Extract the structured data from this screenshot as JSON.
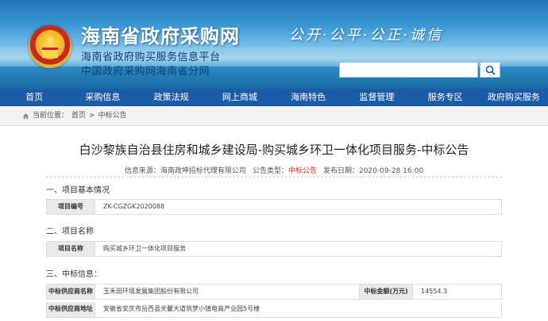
{
  "banner": {
    "site_title": "海南省政府采购网",
    "subtitle_1": "海南省政府购买服务信息平台",
    "subtitle_2": "中国政府采购网海南省分网",
    "slogan": "公开·公平·公正·诚信",
    "search_placeholder": ""
  },
  "nav": {
    "items": [
      "首页",
      "采购信息",
      "政策法规",
      "网上商城",
      "海南特色",
      "监督管理",
      "服务专区",
      "政府购买服务"
    ]
  },
  "breadcrumb": {
    "prefix": "当前位置：",
    "home": "首页",
    "separator": ">",
    "current": "中标公告"
  },
  "article": {
    "title": "白沙黎族自治县住房和城乡建设局-购买城乡环卫一体化项目服务-中标公告",
    "source_label": "信息来源：",
    "source_value": "海南政坤招标代理有限公司",
    "type_label": "公告类型：",
    "type_value": "中标公告",
    "date_label": "发布日期：",
    "date_value": "2020-09-28 16:00"
  },
  "sections": {
    "s1": {
      "heading": "一、项目基本情况",
      "label": "项目编号",
      "value": "ZK-CGZGK2020088"
    },
    "s2": {
      "heading": "二、项目名称",
      "label": "项目名称",
      "value": "购买城乡环卫一体化项目服务"
    },
    "s3": {
      "heading": "三、中标信息：",
      "supplier_label": "中标供应商名称",
      "supplier_value": "玉禾田环境发展集团股份有限公司",
      "amount_label": "中标金额(万元)",
      "amount_value": "14554.3",
      "address_label": "中标供应商地址",
      "address_value": "安徽省安庆市岳西县天馨大道筑梦小镇电商产业园5号楼"
    }
  },
  "colors": {
    "nav_bg": "#1c5ba8",
    "accent_red": "#d9251c",
    "title_text": "#222222"
  }
}
